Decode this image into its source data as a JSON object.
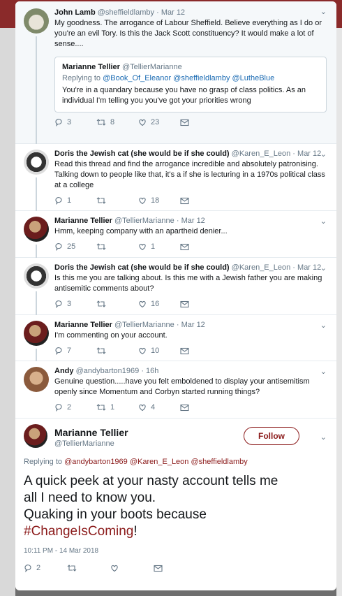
{
  "top_tweet": {
    "name": "John Lamb",
    "handle": "@sheffieldlamby",
    "time": "Mar 12",
    "text": "My goodness. The arrogance of Labour Sheffield. Believe everything as I do or you're an evil Tory.  Is this the Jack Scott constituency? It would make a lot of sense....",
    "quote": {
      "name": "Marianne Tellier",
      "handle": "@TellierMarianne",
      "replying_prefix": "Replying to",
      "replying_handles": "@Book_Of_Eleanor @sheffieldlamby @LutheBlue",
      "text": "You're in a quandary because you have no grasp of class politics. As an individual I'm telling you you've got your priorities wrong"
    },
    "replies": "3",
    "retweets": "8",
    "likes": "23"
  },
  "tweets": [
    {
      "name": "Doris the Jewish cat (she would be if she could)",
      "handle": "@Karen_E_Leon",
      "time": "Mar 12",
      "text": "Read this thread and find the arrogance incredible and absolutely patronising. Talking down to people like that, it's a if she is lecturing in a 1970s political class at a college",
      "replies": "1",
      "retweets": "",
      "likes": "18"
    },
    {
      "name": "Marianne Tellier",
      "handle": "@TellierMarianne",
      "time": "Mar 12",
      "text": "Hmm, keeping company with an apartheid denier...",
      "replies": "25",
      "retweets": "",
      "likes": "1"
    },
    {
      "name": "Doris the Jewish cat (she would be if she could)",
      "handle": "@Karen_E_Leon",
      "time": "Mar 12",
      "text": "Is this me you are talking about. Is this me with a Jewish father you are making antisemitic comments about?",
      "replies": "3",
      "retweets": "",
      "likes": "16"
    },
    {
      "name": "Marianne Tellier",
      "handle": "@TellierMarianne",
      "time": "Mar 12",
      "text": "I'm commenting on your account.",
      "replies": "7",
      "retweets": "",
      "likes": "10"
    },
    {
      "name": "Andy",
      "handle": "@andybarton1969",
      "time": "16h",
      "text": "Genuine question.....have you felt emboldened to display your antisemitism openly since Momentum and Corbyn started running things?",
      "replies": "2",
      "retweets": "1",
      "likes": "4"
    }
  ],
  "main_tweet": {
    "name": "Marianne Tellier",
    "handle": "@TellierMarianne",
    "follow_label": "Follow",
    "replying_prefix": "Replying to",
    "replying_handles": "@andybarton1969 @Karen_E_Leon @sheffieldlamby",
    "text_line1": "A quick peek at your nasty account tells me",
    "text_line2": "all I need to know you.",
    "text_line3": "Quaking in your boots because",
    "hashtag": "#ChangeIsComing",
    "text_end": "!",
    "timestamp": "10:11 PM - 14 Mar 2018",
    "replies": "2",
    "retweets": "",
    "likes": ""
  },
  "colors": {
    "accent": "#8b1a1a",
    "link": "#1b6bb3",
    "muted": "#657786"
  }
}
